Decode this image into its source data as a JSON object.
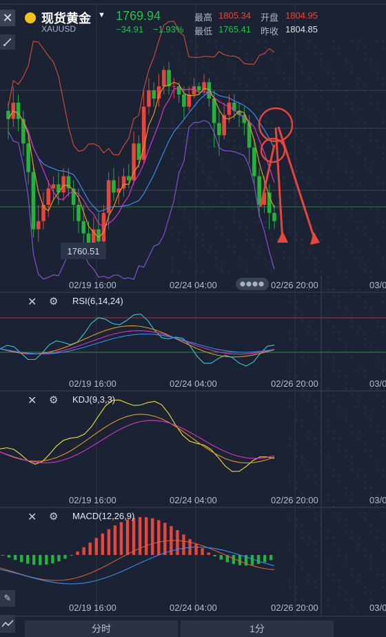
{
  "header": {
    "title": "现货黄金",
    "symbol": "XAUUSD",
    "price": "1769.94",
    "change": "−34.91",
    "change_pct": "−1.93%",
    "high_label": "最高",
    "high": "1805.34",
    "open_label": "开盘",
    "open": "1804.95",
    "low_label": "最低",
    "low": "1765.41",
    "prev_close_label": "昨收",
    "prev_close": "1804.85"
  },
  "colors": {
    "up": "#e8453c",
    "down": "#22b33a",
    "bg": "#1b2233",
    "accent": "#ffcc00"
  },
  "price_marker": "1760.51",
  "panels": {
    "rsi_label": "RSI(6,14,24)",
    "kdj_label": "KDJ(9,3,3)",
    "macd_label": "MACD(12,26,9)"
  },
  "time_axis": [
    "02/19 16:00",
    "02/24 04:00",
    "02/26 20:00",
    "03/0"
  ],
  "bottom_bar": {
    "left": "分时",
    "right": "1分"
  },
  "icons": [
    "close-icon",
    "draw-tool-icon",
    "settings-icon",
    "pencil-icon",
    "indicator-icon"
  ],
  "chart_data": {
    "type": "candlestick",
    "price_range": [
      1758,
      1812
    ],
    "candles": [
      [
        1795,
        1793,
        1797,
        1788
      ],
      [
        1793,
        1797,
        1801,
        1791
      ],
      [
        1797,
        1793,
        1799,
        1790
      ],
      [
        1793,
        1787,
        1795,
        1784
      ],
      [
        1787,
        1780,
        1789,
        1777
      ],
      [
        1780,
        1766,
        1782,
        1764
      ],
      [
        1766,
        1768,
        1772,
        1763
      ],
      [
        1768,
        1772,
        1775,
        1766
      ],
      [
        1772,
        1776,
        1778,
        1769
      ],
      [
        1776,
        1777,
        1779,
        1773
      ],
      [
        1777,
        1775,
        1780,
        1772
      ],
      [
        1775,
        1779,
        1781,
        1773
      ],
      [
        1779,
        1776,
        1781,
        1774
      ],
      [
        1776,
        1772,
        1778,
        1768
      ],
      [
        1772,
        1768,
        1776,
        1765
      ],
      [
        1768,
        1765,
        1772,
        1762
      ],
      [
        1765,
        1762,
        1768,
        1759
      ],
      [
        1762,
        1766,
        1769,
        1760
      ],
      [
        1766,
        1763,
        1770,
        1761
      ],
      [
        1763,
        1770,
        1772,
        1762
      ],
      [
        1770,
        1778,
        1780,
        1766
      ],
      [
        1778,
        1775,
        1781,
        1773
      ],
      [
        1775,
        1776,
        1779,
        1772
      ],
      [
        1776,
        1779,
        1781,
        1774
      ],
      [
        1779,
        1778,
        1782,
        1776
      ],
      [
        1778,
        1787,
        1790,
        1777
      ],
      [
        1787,
        1783,
        1789,
        1781
      ],
      [
        1783,
        1796,
        1800,
        1782
      ],
      [
        1796,
        1800,
        1803,
        1794
      ],
      [
        1800,
        1798,
        1802,
        1796
      ],
      [
        1798,
        1801,
        1804,
        1796
      ],
      [
        1801,
        1805,
        1806,
        1799
      ],
      [
        1805,
        1801,
        1807,
        1799
      ],
      [
        1801,
        1801,
        1803,
        1798
      ],
      [
        1801,
        1799,
        1802,
        1797
      ],
      [
        1799,
        1796,
        1801,
        1793
      ],
      [
        1796,
        1799,
        1801,
        1795
      ],
      [
        1799,
        1801,
        1803,
        1798
      ],
      [
        1801,
        1800,
        1802,
        1799
      ],
      [
        1800,
        1802,
        1804,
        1799
      ],
      [
        1802,
        1798,
        1803,
        1796
      ],
      [
        1798,
        1792,
        1800,
        1786
      ],
      [
        1792,
        1789,
        1795,
        1784
      ],
      [
        1789,
        1794,
        1797,
        1788
      ],
      [
        1794,
        1797,
        1799,
        1792
      ],
      [
        1797,
        1795,
        1799,
        1793
      ],
      [
        1795,
        1794,
        1797,
        1791
      ],
      [
        1794,
        1792,
        1796,
        1789
      ],
      [
        1792,
        1786,
        1794,
        1782
      ],
      [
        1786,
        1779,
        1788,
        1777
      ],
      [
        1779,
        1772,
        1781,
        1769
      ],
      [
        1772,
        1775,
        1779,
        1770
      ],
      [
        1775,
        1770,
        1777,
        1766
      ],
      [
        1770,
        1768,
        1772,
        1766
      ]
    ],
    "markers": {
      "low_label_value": 1760.51
    }
  }
}
